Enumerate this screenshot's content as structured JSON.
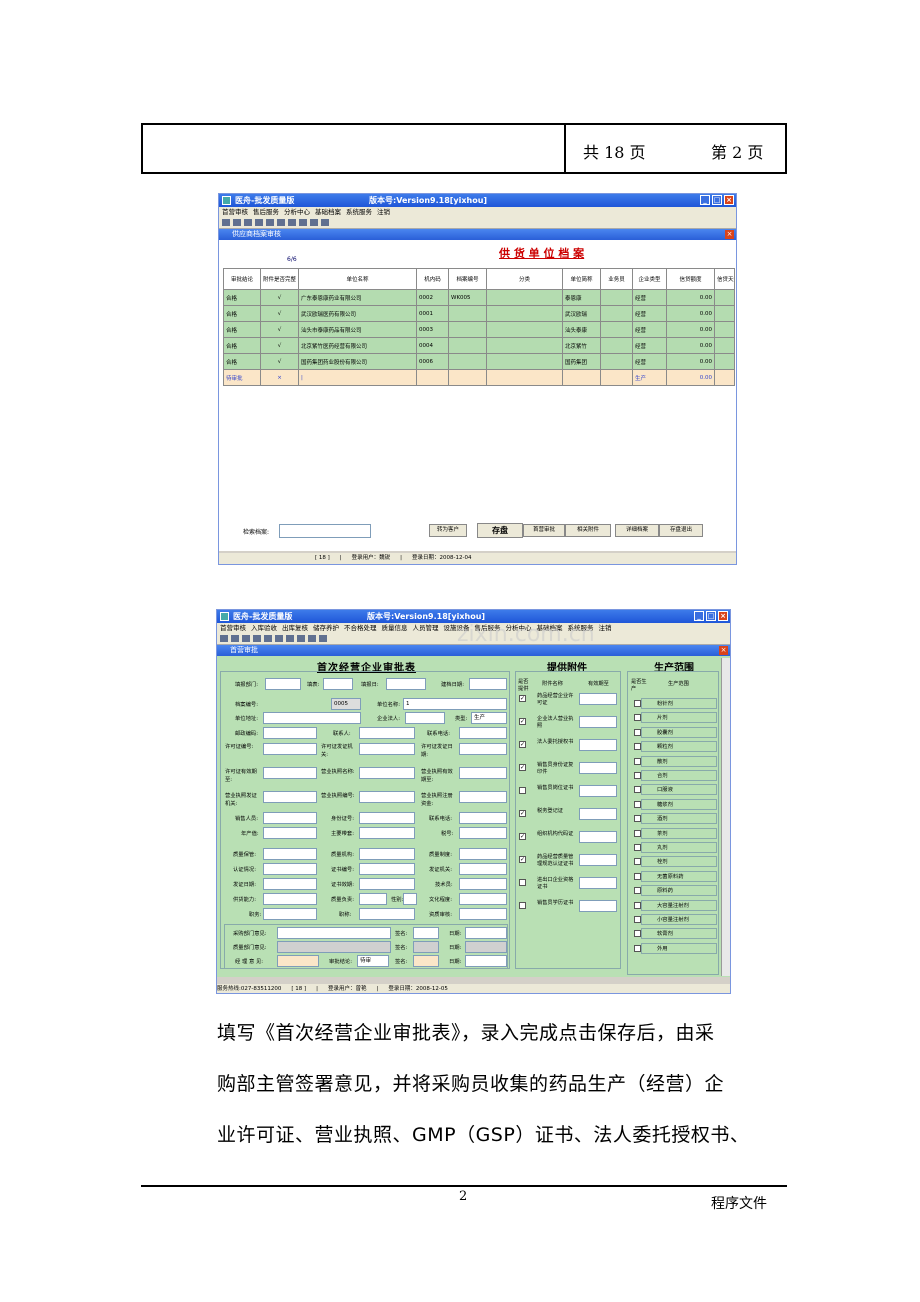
{
  "header": {
    "total_pages": "共 18 页",
    "current_page": "第 2 页"
  },
  "win1": {
    "title": "医舟-批发质量版",
    "version": "版本号:Version9.18[yixhou]",
    "menu": [
      "首营审核",
      "售后服务",
      "分析中心",
      "基础档案",
      "系统服务",
      "注销"
    ],
    "subtitle": "供应商档案审核",
    "heading": "供 货 单 位 档 案",
    "count": "6/6",
    "columns": [
      "审批结论",
      "附件是否完整",
      "单位名称",
      "机内码",
      "档案编号",
      "分类",
      "单位简称",
      "业务员",
      "企业类型",
      "信贷额度",
      "信贷天数"
    ],
    "rows": [
      [
        "合格",
        "√",
        "广东泰恩康药业有限公司",
        "0002",
        "WK005",
        "",
        "泰恩康",
        "",
        "经营",
        "0.00"
      ],
      [
        "合格",
        "√",
        "武汉欧瑞医药有限公司",
        "0001",
        "",
        "",
        "武汉欧瑞",
        "",
        "经营",
        "0.00"
      ],
      [
        "合格",
        "√",
        "汕头市泰康药品有限公司",
        "0003",
        "",
        "",
        "汕头泰康",
        "",
        "经营",
        "0.00"
      ],
      [
        "合格",
        "√",
        "北京紫竹医药经营有限公司",
        "0004",
        "",
        "",
        "北京紫竹",
        "",
        "经营",
        "0.00"
      ],
      [
        "合格",
        "√",
        "国药集团药业股份有限公司",
        "0006",
        "",
        "",
        "国药集团",
        "",
        "经营",
        "0.00"
      ]
    ],
    "pending": [
      "待审批",
      "×",
      "",
      "",
      "",
      "",
      "",
      "",
      "生产",
      "0.00"
    ],
    "search_label": "检索档案:",
    "buttons": [
      "转为客户",
      "存盘",
      "首营审批",
      "相关附件",
      "详细档案",
      "存盘退出"
    ],
    "status": [
      "[ 18 ]",
      "|",
      "登录用户：魏锐",
      "|",
      "登录日期：2008-12-04"
    ]
  },
  "win2": {
    "title": "医舟-批发质量版",
    "version": "版本号:Version9.18[yixhou]",
    "watermark": "zixin.com.cn",
    "menu": [
      "首营审核",
      "入库验收",
      "出库复核",
      "储存养护",
      "不合格处理",
      "质量信息",
      "人员管理",
      "设施设备",
      "售后服务",
      "分析中心",
      "基础档案",
      "系统服务",
      "注销"
    ],
    "subtitle": "首营审批",
    "form_title": "首次经营企业审批表",
    "attach_title": "提供附件",
    "scope_title": "生产范围",
    "labels": {
      "dept": "填报部门:",
      "filler": "填表:",
      "fill_date": "填报日:",
      "create_date": "建档日期:",
      "file_no": "档案编号:",
      "unit_name": "单位名称:",
      "address": "单位地址:",
      "legal": "企业法人:",
      "type": "类型:",
      "postcode": "邮政编码:",
      "contact": "联系人:",
      "phone": "联系电话:",
      "permit_no": "许可证编号:",
      "permit_org": "许可证发证机关:",
      "permit_date": "许可证发证日期:",
      "permit_valid": "许可证有效期至:",
      "biz_name": "营业执照名称:",
      "biz_valid": "营业执照有效期至:",
      "biz_org": "营业执照发证机关:",
      "biz_no": "营业执照编号:",
      "biz_capital": "营业执照注册资金:",
      "sales": "销售人员:",
      "id_no": "身份证号:",
      "sales_phone": "联系电话:",
      "output": "年产值:",
      "products": "主要带套:",
      "tax": "税号:",
      "q_mgr": "质量保管:",
      "q_org": "质量机构:",
      "q_system": "质量制度:",
      "cert": "认证情况:",
      "cert_no": "证书编号:",
      "cert_org": "发证机关:",
      "cert_date": "发证日期:",
      "cert_valid": "证书效期:",
      "tech": "技术员:",
      "supply": "供货能力:",
      "q_owner": "质量负责:",
      "gender": "性别:",
      "edu": "文化程度:",
      "job": "职务:",
      "title": "职称:",
      "evidence": "资质审核:",
      "purchase_opinion": "采购部门意见:",
      "quality_opinion": "质量部门意见:",
      "manager_opinion": "经 理 意 见:",
      "sign": "签名:",
      "date": "日期:",
      "conclusion": "审批结论:"
    },
    "values": {
      "file_no": "0005",
      "unit_name": "1",
      "type": "生产",
      "conclusion": "待审"
    },
    "attach_headers": [
      "是否提供",
      "附件名称",
      "有效期至"
    ],
    "attachments": [
      {
        "name": "药品经营企业许可证",
        "checked": true
      },
      {
        "name": "企业法人营业执照",
        "checked": true
      },
      {
        "name": "法人委托授权书",
        "checked": true
      },
      {
        "name": "销售员身份证复印件",
        "checked": true
      },
      {
        "name": "销售员岗位证书",
        "checked": false
      },
      {
        "name": "税务登记证",
        "checked": true
      },
      {
        "name": "组织机构代码证",
        "checked": true
      },
      {
        "name": "药品经营质量管理规范认证证书",
        "checked": true
      },
      {
        "name": "进出口企业资格证书",
        "checked": false
      },
      {
        "name": "销售员学历证书",
        "checked": false
      }
    ],
    "scope_headers": [
      "是否生产",
      "生产范围"
    ],
    "scopes": [
      "粉针剂",
      "片剂",
      "胶囊剂",
      "颗粒剂",
      "散剂",
      "合剂",
      "口服液",
      "糖浆剂",
      "酒剂",
      "茶剂",
      "丸剂",
      "栓剂",
      "无菌原料药",
      "原料药",
      "大容量注射剂",
      "小容量注射剂",
      "软膏剂",
      "外用"
    ],
    "status": [
      "服务热线:027-83511200",
      "[ 18 ]",
      "|",
      "登录用户：曾艳",
      "|",
      "登录日期：2008-12-05"
    ]
  },
  "body": {
    "lines": [
      "填写《首次经营企业审批表》，录入完成点击保存后，由采",
      "购部主管签署意见，并将采购员收集的药品生产（经营）企",
      "业许可证、营业执照、GMP（GSP）证书、法人委托授权书、"
    ]
  },
  "footer": {
    "page_number": "2",
    "doc_type": "程序文件"
  }
}
